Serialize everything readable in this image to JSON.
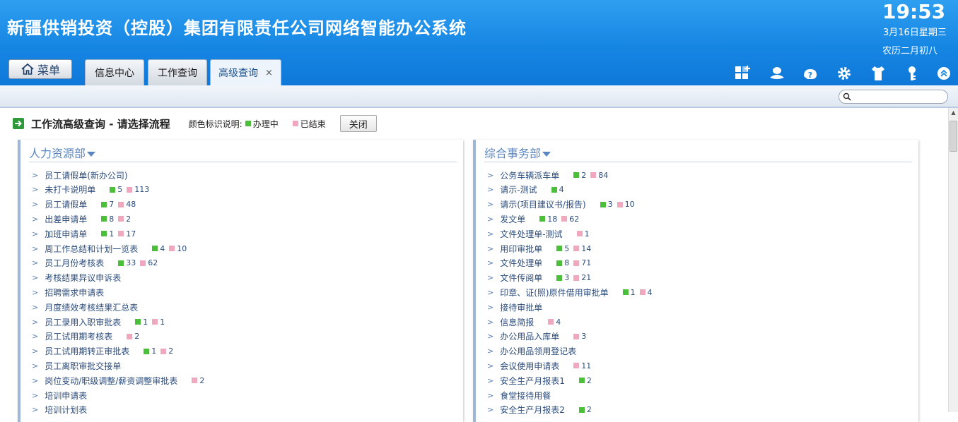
{
  "header": {
    "title": "新疆供销投资（控股）集团有限责任公司网络智能办公系统",
    "clock": "19:53",
    "date": "3月16日星期三",
    "lunar": "农历二月初八"
  },
  "menu_label": "菜单",
  "tabs": [
    {
      "label": "信息中心"
    },
    {
      "label": "工作查询"
    },
    {
      "label": "高级查询",
      "close": "×"
    }
  ],
  "icons": [
    "add-widget-icon",
    "user-icon",
    "help-icon",
    "settings-icon",
    "shirt-icon",
    "key-icon",
    "collapse-up-icon"
  ],
  "search": {
    "value": "",
    "placeholder": ""
  },
  "heading": {
    "title": "工作流高级查询 - 请选择流程",
    "legend_label": "颜色标识说明:",
    "legend_in_progress": "办理中",
    "legend_ended": "已结束",
    "close_button": "关闭"
  },
  "colors": {
    "in_progress": "#4bbf3a",
    "ended": "#f0a8bf",
    "accent": "#1686e3",
    "panel_title": "#5b86bf"
  },
  "panels": [
    {
      "title": "人力资源部",
      "items": [
        {
          "name": "员工请假单(新办公司)"
        },
        {
          "name": "未打卡说明单",
          "g": "5",
          "p": "113"
        },
        {
          "name": "员工请假单",
          "g": "7",
          "p": "48"
        },
        {
          "name": "出差申请单",
          "g": "8",
          "p": "2"
        },
        {
          "name": "加班申请单",
          "g": "1",
          "p": "17"
        },
        {
          "name": "周工作总结和计划一览表",
          "g": "4",
          "p": "10"
        },
        {
          "name": "员工月份考核表",
          "g": "33",
          "p": "62"
        },
        {
          "name": "考核结果异议申诉表"
        },
        {
          "name": "招聘需求申请表"
        },
        {
          "name": "月度绩效考核结果汇总表"
        },
        {
          "name": "员工录用入职审批表",
          "g": "1",
          "p": "1"
        },
        {
          "name": "员工试用期考核表",
          "p": "2"
        },
        {
          "name": "员工试用期转正审批表",
          "g": "1",
          "p": "2"
        },
        {
          "name": "员工离职审批交接单"
        },
        {
          "name": "岗位变动/职级调整/薪资调整审批表",
          "p": "2"
        },
        {
          "name": "培训申请表"
        },
        {
          "name": "培训计划表"
        }
      ]
    },
    {
      "title": "综合事务部",
      "items": [
        {
          "name": "公务车辆派车单",
          "g": "2",
          "p": "84"
        },
        {
          "name": "请示-测试",
          "g": "4"
        },
        {
          "name": "请示(项目建议书/报告)",
          "g": "3",
          "p": "10"
        },
        {
          "name": "发文单",
          "g": "18",
          "p": "62"
        },
        {
          "name": "文件处理单-测试",
          "p": "1"
        },
        {
          "name": "用印审批单",
          "g": "5",
          "p": "14"
        },
        {
          "name": "文件处理单",
          "g": "8",
          "p": "71"
        },
        {
          "name": "文件传阅单",
          "g": "3",
          "p": "21"
        },
        {
          "name": "印章、证(照)原件借用审批单",
          "g": "1",
          "p": "4"
        },
        {
          "name": "接待审批单"
        },
        {
          "name": "信息简报",
          "p": "4"
        },
        {
          "name": "办公用品入库单",
          "p": "3"
        },
        {
          "name": "办公用品领用登记表"
        },
        {
          "name": "会议使用申请表",
          "p": "11"
        },
        {
          "name": "安全生产月报表1",
          "g": "2"
        },
        {
          "name": "食堂接待用餐"
        },
        {
          "name": "安全生产月报表2",
          "g": "2"
        }
      ]
    }
  ]
}
